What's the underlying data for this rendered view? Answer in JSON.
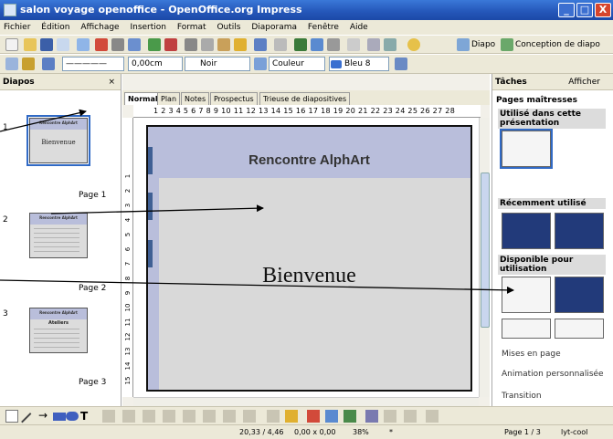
{
  "window": {
    "title": "salon voyage openoffice - OpenOffice.org Impress",
    "min": "_",
    "max": "□",
    "close": "X"
  },
  "menu": [
    "Fichier",
    "Édition",
    "Affichage",
    "Insertion",
    "Format",
    "Outils",
    "Diaporama",
    "Fenêtre",
    "Aide"
  ],
  "toolbar": {
    "diapo": "Diapo",
    "conception": "Conception de diapo"
  },
  "format_bar": {
    "line_width": "0,00cm",
    "line_color": "Noir",
    "fill_mode": "Couleur",
    "fill_color": "Bleu 8"
  },
  "diapos_panel": {
    "title": "Diapos",
    "close": "×",
    "slides": [
      {
        "num": "1",
        "label": "Page 1",
        "thumb_title": "Rencontre AlphArt",
        "thumb_body": "Bienvenue"
      },
      {
        "num": "2",
        "label": "Page 2",
        "thumb_title": "Rencontre AlphArt",
        "thumb_body": ""
      },
      {
        "num": "3",
        "label": "Page 3",
        "thumb_title": "Rencontre AlphArt",
        "thumb_body": "Ateliers"
      }
    ]
  },
  "view_tabs": [
    "Normal",
    "Plan",
    "Notes",
    "Prospectus",
    "Trieuse de diapositives"
  ],
  "ruler": {
    "h": "1 2 3 4 5 6 7 8 9 10 11 12 13 14 15 16 17 18 19 20 21 22 23 24 25 26 27 28"
  },
  "slide": {
    "title": "Rencontre AlphArt",
    "body": "Bienvenue"
  },
  "tasks": {
    "title": "Tâches",
    "afficher": "Afficher",
    "master_pages": "Pages maîtresses",
    "used": "Utilisé dans cette présentation",
    "recent": "Récemment utilisé",
    "available": "Disponible pour utilisation",
    "links": [
      "Mises en page",
      "Animation personnalisée",
      "Transition"
    ]
  },
  "status": {
    "pos": "20,33 / 4,46",
    "size": "0,00 x 0,00",
    "zoom": "38%",
    "star": "*",
    "page": "Page 1 / 3",
    "master": "lyt-cool"
  }
}
